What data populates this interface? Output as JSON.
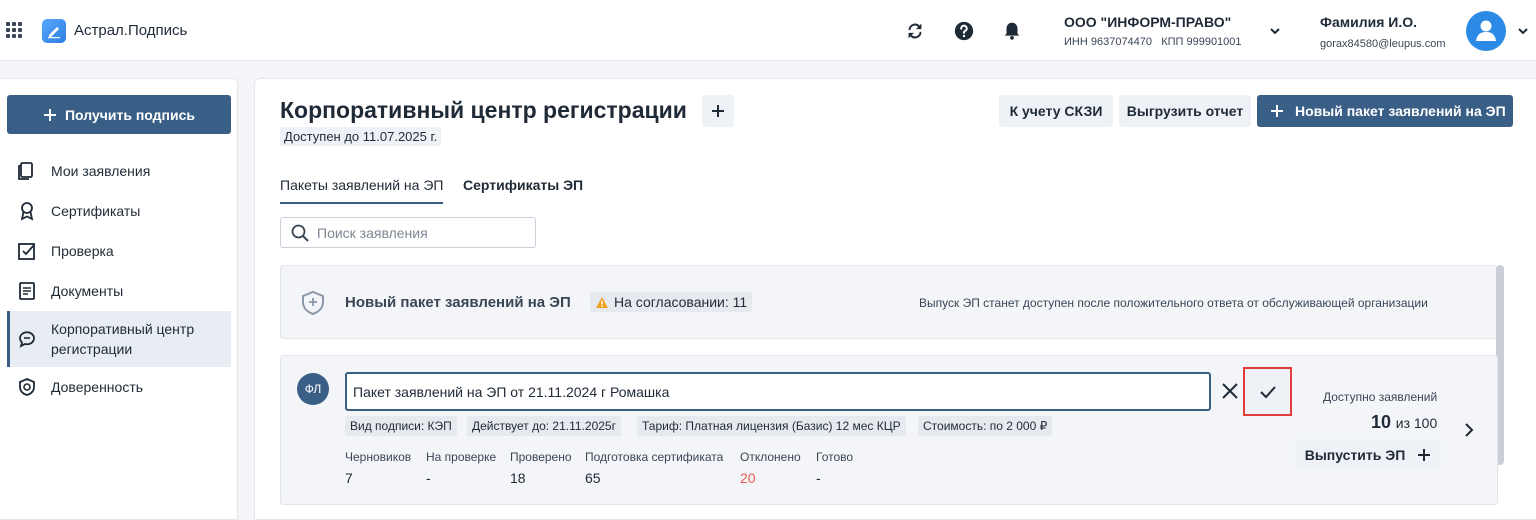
{
  "app": {
    "title": "Астрал.Подпись"
  },
  "org": {
    "name": "ООО \"ИНФОРМ-ПРАВО\"",
    "details": "ИНН 9637074470   КПП 999901001"
  },
  "user": {
    "name": "Фамилия И.О.",
    "email": "gorax84580@leupus.com"
  },
  "sidebar": {
    "get_sign_label": "Получить подпись",
    "items": [
      {
        "label": "Мои заявления",
        "icon": "copy-icon"
      },
      {
        "label": "Сертификаты",
        "icon": "award-icon"
      },
      {
        "label": "Проверка",
        "icon": "check-square-icon"
      },
      {
        "label": "Документы",
        "icon": "document-icon"
      },
      {
        "label": "Корпоративный центр регистрации",
        "icon": "chat-icon",
        "active": true
      },
      {
        "label": "Доверенность",
        "icon": "shield-check-icon"
      }
    ]
  },
  "page": {
    "title": "Корпоративный центр регистрации",
    "available_until": "Доступен до 11.07.2025 г.",
    "buttons": {
      "skzi": "К учету СКЗИ",
      "export": "Выгрузить отчет",
      "new_package": "Новый пакет заявлений на ЭП"
    },
    "tabs": [
      {
        "label": "Пакеты заявлений на ЭП",
        "active": true
      },
      {
        "label": "Сертификаты ЭП",
        "active": false
      }
    ],
    "search": {
      "placeholder": "Поиск заявления",
      "value": ""
    }
  },
  "new_package_card": {
    "title": "Новый пакет заявлений на ЭП",
    "status": "На согласовании: 11",
    "hint": "Выпуск ЭП станет доступен после положительного ответа от обслуживающей организации"
  },
  "package_card": {
    "badge": "ФЛ",
    "name_value": "Пакет заявлений на ЭП от 21.11.2024 г Ромашка",
    "meta": [
      "Вид подписи: КЭП",
      "Действует до: 21.11.2025г",
      "Тариф: Платная лицензия (Базис) 12 мес КЦР",
      "Стоимость: по 2 000 ₽"
    ],
    "stats": [
      {
        "label": "Черновиков",
        "value": "7"
      },
      {
        "label": "На проверке",
        "value": "-"
      },
      {
        "label": "Проверено",
        "value": "18"
      },
      {
        "label": "Подготовка сертификата",
        "value": "65"
      },
      {
        "label": "Отклонено",
        "value": "20"
      },
      {
        "label": "Готово",
        "value": "-"
      }
    ],
    "available_label": "Доступно заявлений",
    "available_used": "10",
    "available_of": "из 100",
    "issue_label": "Выпустить ЭП"
  },
  "colors": {
    "primary": "#3a5f86",
    "accent": "#2b8ae6",
    "danger": "#e23b3b",
    "rejected": "#e85a4f",
    "warning": "#f0a020"
  }
}
